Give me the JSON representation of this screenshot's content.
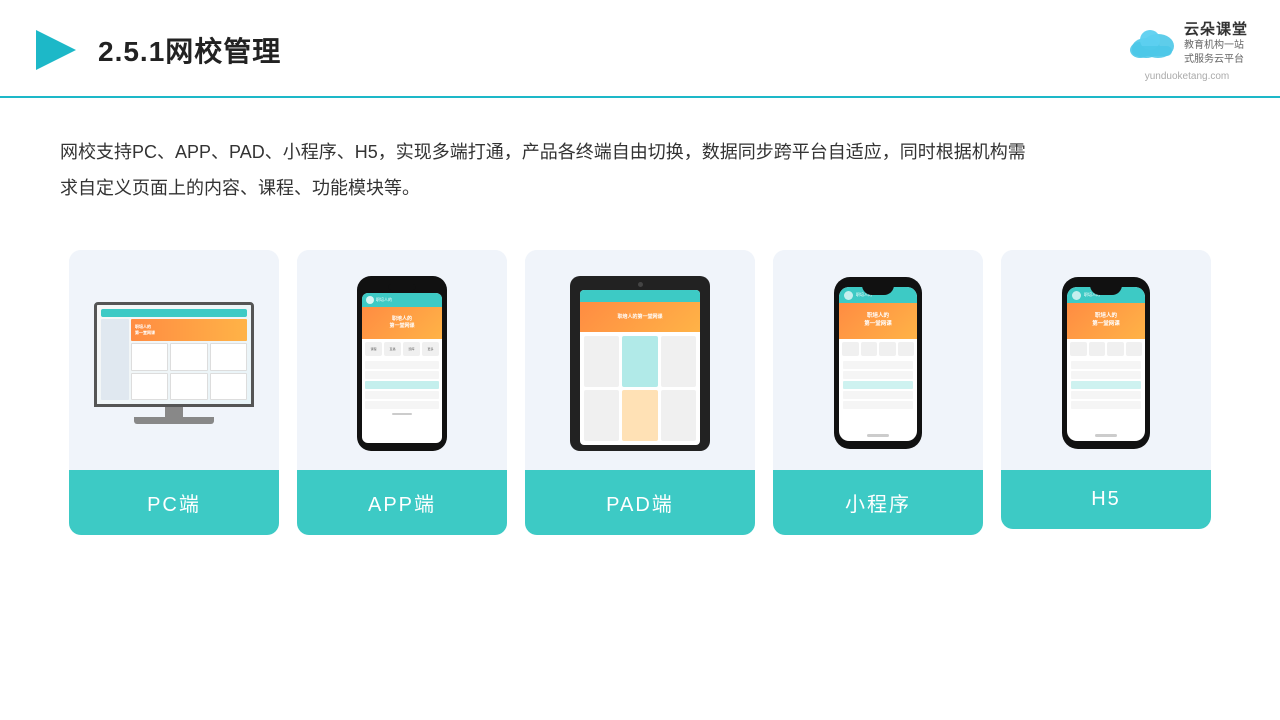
{
  "header": {
    "title": "2.5.1网校管理",
    "section": "2.5.1",
    "title_cn": "网校管理",
    "logo": {
      "name": "云朵课堂",
      "pinyin": "yunduoketang.com",
      "slogan": "教育机构一站\n式服务云平台"
    }
  },
  "description": {
    "text": "网校支持PC、APP、PAD、小程序、H5，实现多端打通，产品各终端自由切换，数据同步跨平台自适应，同时根据机构需求自定义页面上的内容、课程、功能模块等。"
  },
  "cards": [
    {
      "id": "pc",
      "label": "PC端",
      "type": "pc"
    },
    {
      "id": "app",
      "label": "APP端",
      "type": "phone"
    },
    {
      "id": "pad",
      "label": "PAD端",
      "type": "pad"
    },
    {
      "id": "miniprogram",
      "label": "小程序",
      "type": "mini-phone"
    },
    {
      "id": "h5",
      "label": "H5",
      "type": "mini-phone"
    }
  ],
  "colors": {
    "accent": "#3dcac5",
    "card_bg": "#f0f4fa",
    "card_label_bg": "#3dcac5",
    "banner_orange": "#ff8c42",
    "text_dark": "#222",
    "text_body": "#333"
  }
}
